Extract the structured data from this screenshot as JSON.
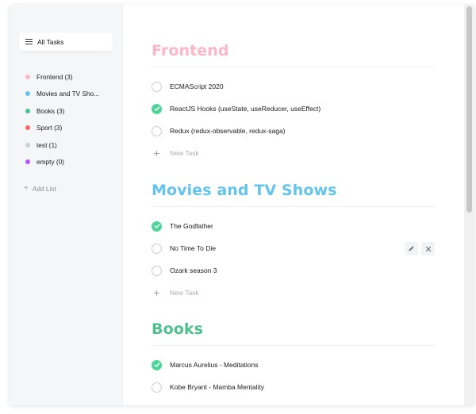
{
  "sidebar": {
    "all_tasks_label": "All Tasks",
    "lists": [
      {
        "label": "Frontend (3)",
        "color": "#fbb6c7"
      },
      {
        "label": "Movies and TV Sho...",
        "color": "#64c4ed"
      },
      {
        "label": "Books (3)",
        "color": "#4dc18f"
      },
      {
        "label": "Sport (3)",
        "color": "#ff6464"
      },
      {
        "label": "test (1)",
        "color": "#c9d1d3"
      },
      {
        "label": "empty (0)",
        "color": "#b556ff"
      }
    ],
    "add_list_label": "Add List"
  },
  "sections": [
    {
      "title": "Frontend",
      "color": "#fbb6c7",
      "tasks": [
        {
          "text": "ECMAScript 2020",
          "done": false
        },
        {
          "text": "ReactJS Hooks (useState, useReducer, useEffect)",
          "done": true
        },
        {
          "text": "Redux (redux-observable, redux-saga)",
          "done": false
        }
      ],
      "new_task_label": "New Task"
    },
    {
      "title": "Movies and TV Shows",
      "color": "#64c4ed",
      "tasks": [
        {
          "text": "The Godfather",
          "done": true
        },
        {
          "text": "No Time To Die",
          "done": false
        },
        {
          "text": "Ozark season 3",
          "done": false
        }
      ],
      "new_task_label": "New Task"
    },
    {
      "title": "Books",
      "color": "#4dc18f",
      "tasks": [
        {
          "text": "Marcus Aurelius - Meditations",
          "done": true
        },
        {
          "text": "Kobe Bryant - Mamba Mentality",
          "done": false
        }
      ]
    }
  ],
  "icons": {
    "all_tasks": "list-icon",
    "add": "plus-icon",
    "check": "check-icon",
    "edit": "pencil-icon",
    "delete": "close-icon"
  },
  "colors": {
    "checked": "#4dd599",
    "sidebar_bg": "#f4f6f8"
  }
}
